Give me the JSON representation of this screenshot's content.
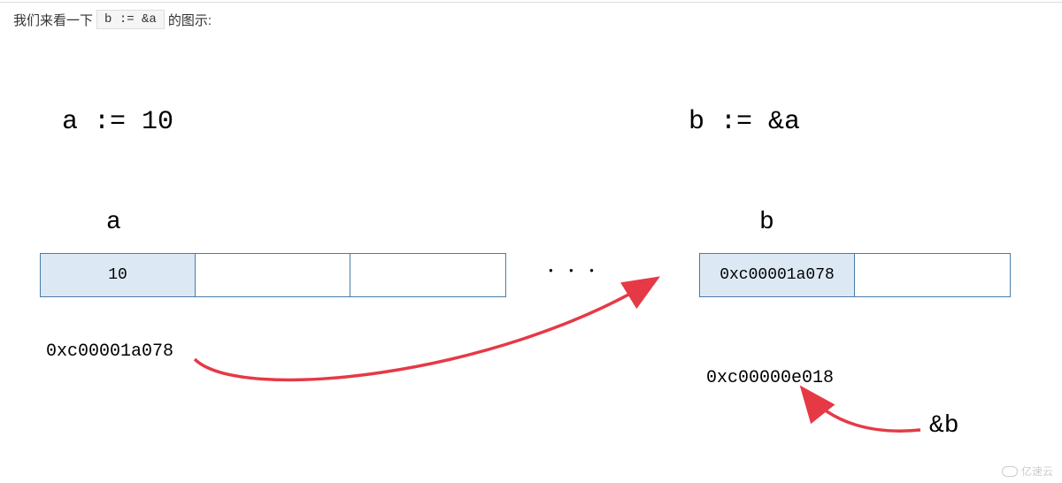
{
  "intro": {
    "text_before": "我们来看一下",
    "code": "b := &a",
    "text_after": "的图示:"
  },
  "diagram": {
    "left_code": "a := 10",
    "right_code": "b := &a",
    "left_var": "a",
    "right_var": "b",
    "left_memory": {
      "cells": [
        "10",
        "",
        ""
      ]
    },
    "right_memory": {
      "cells": [
        "0xc00001a078",
        ""
      ]
    },
    "left_address": "0xc00001a078",
    "right_address": "0xc00000e018",
    "ellipsis": "● ● ●",
    "ref_b": "&b"
  },
  "watermark": {
    "text": "亿速云"
  }
}
